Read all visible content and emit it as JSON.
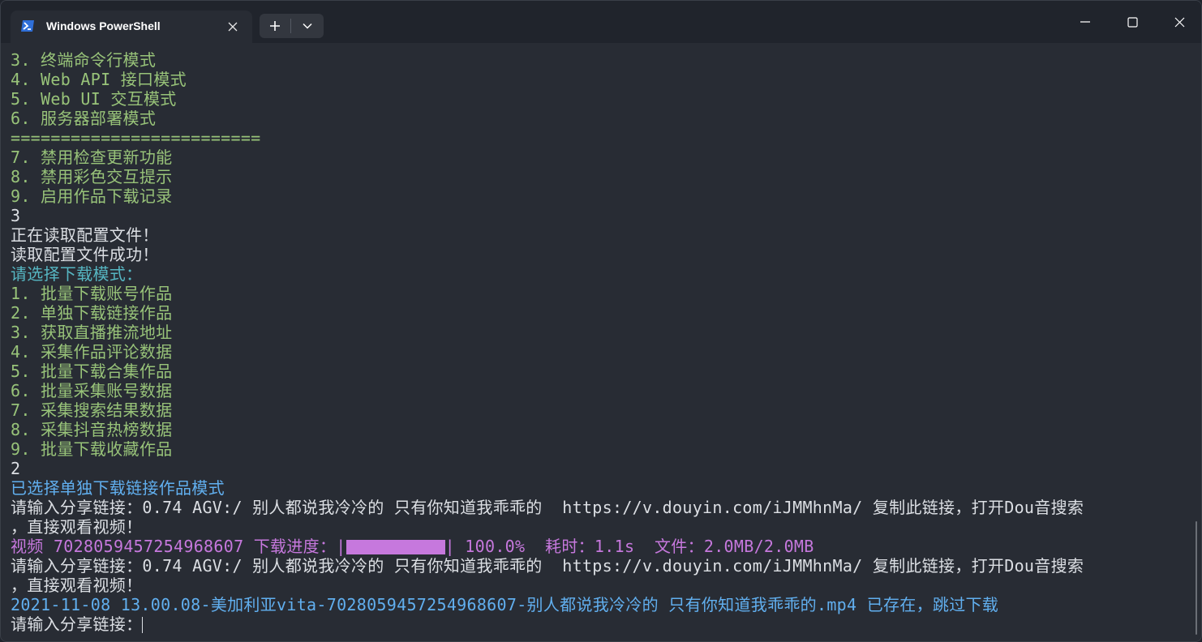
{
  "window": {
    "tab_title": "Windows PowerShell",
    "new_tab_glyph": "+",
    "colors": {
      "background": "#282c34",
      "titlebar": "#20242c"
    }
  },
  "terminal": {
    "lines": [
      {
        "text": "3. 终端命令行模式",
        "color": "#98c379"
      },
      {
        "text": "4. Web API 接口模式",
        "color": "#98c379"
      },
      {
        "text": "5. Web UI 交互模式",
        "color": "#98c379"
      },
      {
        "text": "6. 服务器部署模式",
        "color": "#98c379"
      },
      {
        "text": "=========================",
        "color": "#98c379"
      },
      {
        "text": "7. 禁用检查更新功能",
        "color": "#98c379"
      },
      {
        "text": "8. 禁用彩色交互提示",
        "color": "#98c379"
      },
      {
        "text": "9. 启用作品下载记录",
        "color": "#98c379"
      },
      {
        "text": "3",
        "color": "#dcdfe4"
      },
      {
        "text": "正在读取配置文件！",
        "color": "#dcdfe4"
      },
      {
        "text": "读取配置文件成功！",
        "color": "#dcdfe4"
      },
      {
        "text": "请选择下载模式：",
        "color": "#56b6c2"
      },
      {
        "text": "1. 批量下载账号作品",
        "color": "#98c379"
      },
      {
        "text": "2. 单独下载链接作品",
        "color": "#98c379"
      },
      {
        "text": "3. 获取直播推流地址",
        "color": "#98c379"
      },
      {
        "text": "4. 采集作品评论数据",
        "color": "#98c379"
      },
      {
        "text": "5. 批量下载合集作品",
        "color": "#98c379"
      },
      {
        "text": "6. 批量采集账号数据",
        "color": "#98c379"
      },
      {
        "text": "7. 采集搜索结果数据",
        "color": "#98c379"
      },
      {
        "text": "8. 采集抖音热榜数据",
        "color": "#98c379"
      },
      {
        "text": "9. 批量下载收藏作品",
        "color": "#98c379"
      },
      {
        "text": "2",
        "color": "#dcdfe4"
      },
      {
        "text": "已选择单独下载链接作品模式",
        "color": "#61afef"
      },
      {
        "text": "请输入分享链接：0.74 AGV:/ 别人都说我冷冷的 只有你知道我乖乖的  https://v.douyin.com/iJMMhnMa/ 复制此链接，打开Dou音搜索",
        "color": "#dcdfe4"
      },
      {
        "text": "，直接观看视频！",
        "color": "#dcdfe4"
      }
    ],
    "progress": {
      "prefix": "视频 7028059457254968607 下载进度：|",
      "fraction": 1.0,
      "suffix": "| 100.0%  耗时：1.1s  文件：2.0MB/2.0MB",
      "color": "#c678dd"
    },
    "lines_after": [
      {
        "text": "请输入分享链接：0.74 AGV:/ 别人都说我冷冷的 只有你知道我乖乖的  https://v.douyin.com/iJMMhnMa/ 复制此链接，打开Dou音搜索",
        "color": "#dcdfe4"
      },
      {
        "text": "，直接观看视频！",
        "color": "#dcdfe4"
      },
      {
        "text": "2021-11-08 13.00.08-美加利亚vita-7028059457254968607-别人都说我冷冷的 只有你知道我乖乖的.mp4 已存在，跳过下载",
        "color": "#61afef"
      }
    ],
    "prompt": {
      "text": "请输入分享链接：",
      "color": "#dcdfe4"
    }
  }
}
